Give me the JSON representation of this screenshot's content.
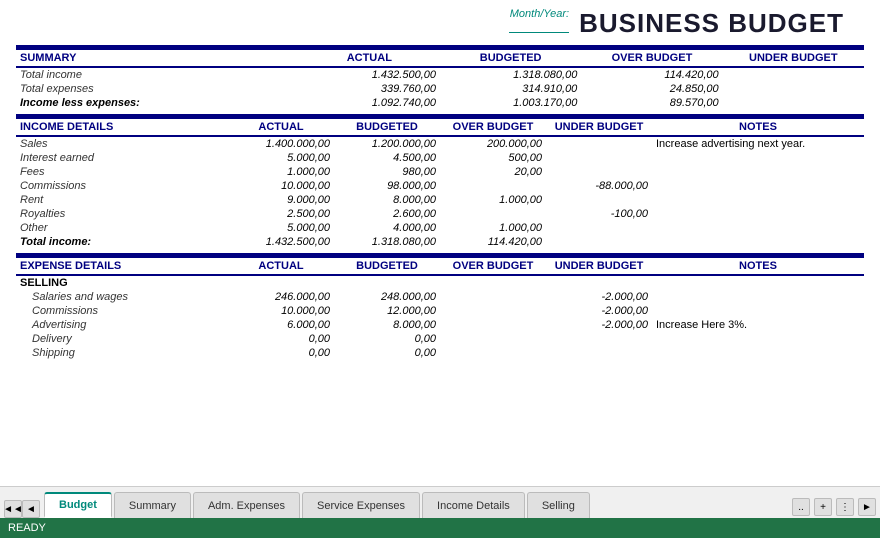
{
  "title": "BUSINESS BUDGET",
  "month_year_label": "Month/Year:",
  "summary": {
    "header": "SUMMARY",
    "columns": [
      "ACTUAL",
      "BUDGETED",
      "OVER BUDGET",
      "UNDER BUDGET"
    ],
    "rows": [
      {
        "label": "Total income",
        "actual": "1.432.500,00",
        "budgeted": "1.318.080,00",
        "over": "114.420,00",
        "under": ""
      },
      {
        "label": "Total expenses",
        "actual": "339.760,00",
        "budgeted": "314.910,00",
        "over": "24.850,00",
        "under": ""
      },
      {
        "label": "Income less expenses:",
        "actual": "1.092.740,00",
        "budgeted": "1.003.170,00",
        "over": "89.570,00",
        "under": "",
        "bold": true
      }
    ]
  },
  "income_details": {
    "header": "INCOME DETAILS",
    "columns": [
      "ACTUAL",
      "BUDGETED",
      "OVER BUDGET",
      "UNDER BUDGET",
      "NOTES"
    ],
    "rows": [
      {
        "label": "Sales",
        "actual": "1.400.000,00",
        "budgeted": "1.200.000,00",
        "over": "200.000,00",
        "under": "",
        "notes": "Increase advertising next year."
      },
      {
        "label": "Interest earned",
        "actual": "5.000,00",
        "budgeted": "4.500,00",
        "over": "500,00",
        "under": "",
        "notes": ""
      },
      {
        "label": "Fees",
        "actual": "1.000,00",
        "budgeted": "980,00",
        "over": "20,00",
        "under": "",
        "notes": ""
      },
      {
        "label": "Commissions",
        "actual": "10.000,00",
        "budgeted": "98.000,00",
        "over": "",
        "under": "-88.000,00",
        "notes": ""
      },
      {
        "label": "Rent",
        "actual": "9.000,00",
        "budgeted": "8.000,00",
        "over": "1.000,00",
        "under": "",
        "notes": ""
      },
      {
        "label": "Royalties",
        "actual": "2.500,00",
        "budgeted": "2.600,00",
        "over": "",
        "under": "-100,00",
        "notes": ""
      },
      {
        "label": "Other",
        "actual": "5.000,00",
        "budgeted": "4.000,00",
        "over": "1.000,00",
        "under": "",
        "notes": ""
      },
      {
        "label": "Total income:",
        "actual": "1.432.500,00",
        "budgeted": "1.318.080,00",
        "over": "114.420,00",
        "under": "",
        "notes": "",
        "bold": true
      }
    ]
  },
  "expense_details": {
    "header": "EXPENSE DETAILS",
    "columns": [
      "ACTUAL",
      "BUDGETED",
      "OVER BUDGET",
      "UNDER BUDGET",
      "NOTES"
    ],
    "selling_header": "SELLING",
    "rows": [
      {
        "label": "Salaries and wages",
        "actual": "246.000,00",
        "budgeted": "248.000,00",
        "over": "",
        "under": "-2.000,00",
        "notes": ""
      },
      {
        "label": "Commissions",
        "actual": "10.000,00",
        "budgeted": "12.000,00",
        "over": "",
        "under": "-2.000,00",
        "notes": ""
      },
      {
        "label": "Advertising",
        "actual": "6.000,00",
        "budgeted": "8.000,00",
        "over": "",
        "under": "-2.000,00",
        "notes": "Increase Here 3%."
      },
      {
        "label": "Delivery",
        "actual": "0,00",
        "budgeted": "0,00",
        "over": "",
        "under": "",
        "notes": ""
      },
      {
        "label": "Shipping",
        "actual": "0,00",
        "budgeted": "0,00",
        "over": "",
        "under": "",
        "notes": ""
      }
    ]
  },
  "tabs": [
    {
      "label": "Budget",
      "active": true
    },
    {
      "label": "Summary",
      "active": false
    },
    {
      "label": "Adm. Expenses",
      "active": false
    },
    {
      "label": "Service Expenses",
      "active": false
    },
    {
      "label": "Income Details",
      "active": false
    },
    {
      "label": "Selling",
      "active": false
    }
  ],
  "status": "READY",
  "nav_buttons": [
    "..",
    "+",
    ":",
    "◄"
  ]
}
